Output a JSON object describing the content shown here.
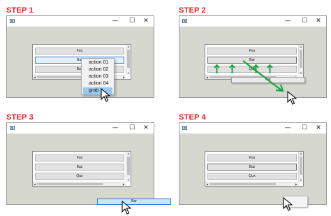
{
  "steps": [
    {
      "title": "STEP 1"
    },
    {
      "title": "STEP 2"
    },
    {
      "title": "STEP 3"
    },
    {
      "title": "STEP 4"
    }
  ],
  "window": {
    "minimize_glyph": "—",
    "maximize_glyph": "☐",
    "close_glyph": "✕"
  },
  "step1": {
    "items": [
      "Foo",
      "Bar",
      "Baz"
    ],
    "context_menu": [
      "action 01",
      "action 02",
      "action 03",
      "action 04",
      "grab"
    ]
  },
  "step2": {
    "items": [
      "Foo",
      "Bar",
      "Qux"
    ],
    "dragged_item": "Bar"
  },
  "step3": {
    "items": [
      "Foo",
      "Baz",
      "Qux"
    ],
    "dragged_item": "Bar"
  },
  "step4": {
    "items": [
      "Foo",
      "Baz",
      "Qux"
    ]
  },
  "colors": {
    "step_title": "#e02020",
    "selection_border": "#2c7be0",
    "menu_highlight": "#99c9ef",
    "drag_bg": "#cde4f7",
    "arrow_green": "#1aa63a"
  },
  "icons": [
    "app-icon",
    "minimize-icon",
    "maximize-icon",
    "close-icon",
    "cursor-icon",
    "up-arrow-icon",
    "diagonal-arrow-icon"
  ]
}
